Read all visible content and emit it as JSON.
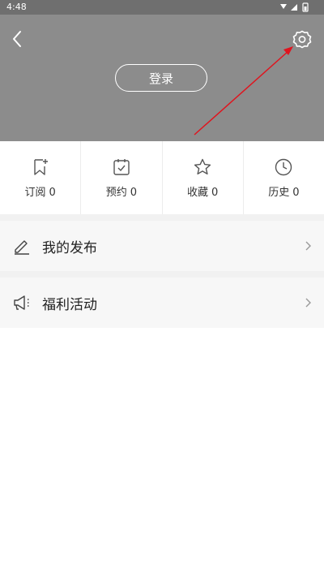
{
  "status_bar": {
    "time": "4:48"
  },
  "header": {
    "login_label": "登录",
    "back_icon": "back-arrow-icon",
    "settings_icon": "gear-icon"
  },
  "stats": [
    {
      "label": "订阅",
      "count": "0",
      "icon": "bookmark-plus-icon"
    },
    {
      "label": "预约",
      "count": "0",
      "icon": "calendar-check-icon"
    },
    {
      "label": "收藏",
      "count": "0",
      "icon": "star-icon"
    },
    {
      "label": "历史",
      "count": "0",
      "icon": "clock-icon"
    }
  ],
  "menu": [
    {
      "label": "我的发布",
      "icon": "pencil-icon"
    },
    {
      "label": "福利活动",
      "icon": "megaphone-icon"
    }
  ],
  "colors": {
    "header_bg": "#8c8c8c",
    "status_bg": "#6f6f6f",
    "annotation_arrow": "#e0141e"
  }
}
